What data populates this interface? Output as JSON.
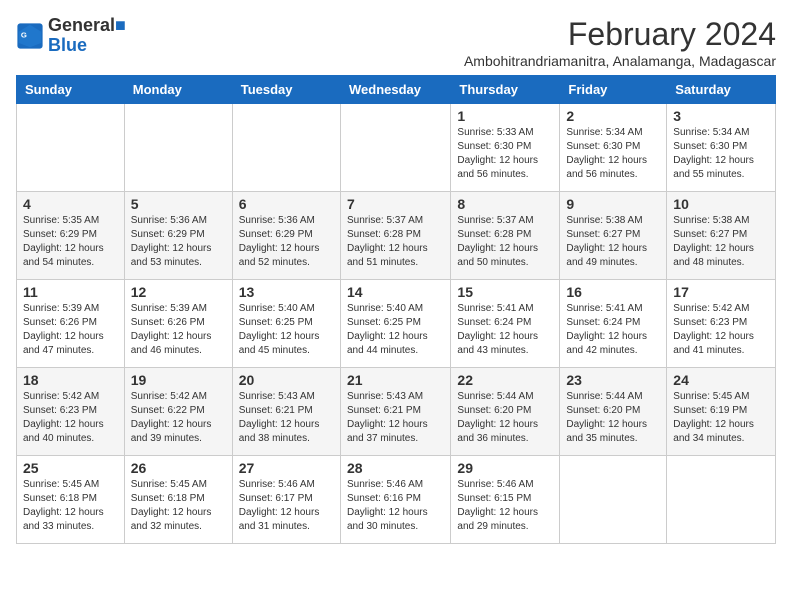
{
  "header": {
    "logo_line1": "General",
    "logo_line2": "Blue",
    "month_title": "February 2024",
    "subtitle": "Ambohitrandriamanitra, Analamanga, Madagascar"
  },
  "days_of_week": [
    "Sunday",
    "Monday",
    "Tuesday",
    "Wednesday",
    "Thursday",
    "Friday",
    "Saturday"
  ],
  "weeks": [
    [
      {
        "day": "",
        "info": ""
      },
      {
        "day": "",
        "info": ""
      },
      {
        "day": "",
        "info": ""
      },
      {
        "day": "",
        "info": ""
      },
      {
        "day": "1",
        "info": "Sunrise: 5:33 AM\nSunset: 6:30 PM\nDaylight: 12 hours\nand 56 minutes."
      },
      {
        "day": "2",
        "info": "Sunrise: 5:34 AM\nSunset: 6:30 PM\nDaylight: 12 hours\nand 56 minutes."
      },
      {
        "day": "3",
        "info": "Sunrise: 5:34 AM\nSunset: 6:30 PM\nDaylight: 12 hours\nand 55 minutes."
      }
    ],
    [
      {
        "day": "4",
        "info": "Sunrise: 5:35 AM\nSunset: 6:29 PM\nDaylight: 12 hours\nand 54 minutes."
      },
      {
        "day": "5",
        "info": "Sunrise: 5:36 AM\nSunset: 6:29 PM\nDaylight: 12 hours\nand 53 minutes."
      },
      {
        "day": "6",
        "info": "Sunrise: 5:36 AM\nSunset: 6:29 PM\nDaylight: 12 hours\nand 52 minutes."
      },
      {
        "day": "7",
        "info": "Sunrise: 5:37 AM\nSunset: 6:28 PM\nDaylight: 12 hours\nand 51 minutes."
      },
      {
        "day": "8",
        "info": "Sunrise: 5:37 AM\nSunset: 6:28 PM\nDaylight: 12 hours\nand 50 minutes."
      },
      {
        "day": "9",
        "info": "Sunrise: 5:38 AM\nSunset: 6:27 PM\nDaylight: 12 hours\nand 49 minutes."
      },
      {
        "day": "10",
        "info": "Sunrise: 5:38 AM\nSunset: 6:27 PM\nDaylight: 12 hours\nand 48 minutes."
      }
    ],
    [
      {
        "day": "11",
        "info": "Sunrise: 5:39 AM\nSunset: 6:26 PM\nDaylight: 12 hours\nand 47 minutes."
      },
      {
        "day": "12",
        "info": "Sunrise: 5:39 AM\nSunset: 6:26 PM\nDaylight: 12 hours\nand 46 minutes."
      },
      {
        "day": "13",
        "info": "Sunrise: 5:40 AM\nSunset: 6:25 PM\nDaylight: 12 hours\nand 45 minutes."
      },
      {
        "day": "14",
        "info": "Sunrise: 5:40 AM\nSunset: 6:25 PM\nDaylight: 12 hours\nand 44 minutes."
      },
      {
        "day": "15",
        "info": "Sunrise: 5:41 AM\nSunset: 6:24 PM\nDaylight: 12 hours\nand 43 minutes."
      },
      {
        "day": "16",
        "info": "Sunrise: 5:41 AM\nSunset: 6:24 PM\nDaylight: 12 hours\nand 42 minutes."
      },
      {
        "day": "17",
        "info": "Sunrise: 5:42 AM\nSunset: 6:23 PM\nDaylight: 12 hours\nand 41 minutes."
      }
    ],
    [
      {
        "day": "18",
        "info": "Sunrise: 5:42 AM\nSunset: 6:23 PM\nDaylight: 12 hours\nand 40 minutes."
      },
      {
        "day": "19",
        "info": "Sunrise: 5:42 AM\nSunset: 6:22 PM\nDaylight: 12 hours\nand 39 minutes."
      },
      {
        "day": "20",
        "info": "Sunrise: 5:43 AM\nSunset: 6:21 PM\nDaylight: 12 hours\nand 38 minutes."
      },
      {
        "day": "21",
        "info": "Sunrise: 5:43 AM\nSunset: 6:21 PM\nDaylight: 12 hours\nand 37 minutes."
      },
      {
        "day": "22",
        "info": "Sunrise: 5:44 AM\nSunset: 6:20 PM\nDaylight: 12 hours\nand 36 minutes."
      },
      {
        "day": "23",
        "info": "Sunrise: 5:44 AM\nSunset: 6:20 PM\nDaylight: 12 hours\nand 35 minutes."
      },
      {
        "day": "24",
        "info": "Sunrise: 5:45 AM\nSunset: 6:19 PM\nDaylight: 12 hours\nand 34 minutes."
      }
    ],
    [
      {
        "day": "25",
        "info": "Sunrise: 5:45 AM\nSunset: 6:18 PM\nDaylight: 12 hours\nand 33 minutes."
      },
      {
        "day": "26",
        "info": "Sunrise: 5:45 AM\nSunset: 6:18 PM\nDaylight: 12 hours\nand 32 minutes."
      },
      {
        "day": "27",
        "info": "Sunrise: 5:46 AM\nSunset: 6:17 PM\nDaylight: 12 hours\nand 31 minutes."
      },
      {
        "day": "28",
        "info": "Sunrise: 5:46 AM\nSunset: 6:16 PM\nDaylight: 12 hours\nand 30 minutes."
      },
      {
        "day": "29",
        "info": "Sunrise: 5:46 AM\nSunset: 6:15 PM\nDaylight: 12 hours\nand 29 minutes."
      },
      {
        "day": "",
        "info": ""
      },
      {
        "day": "",
        "info": ""
      }
    ]
  ]
}
